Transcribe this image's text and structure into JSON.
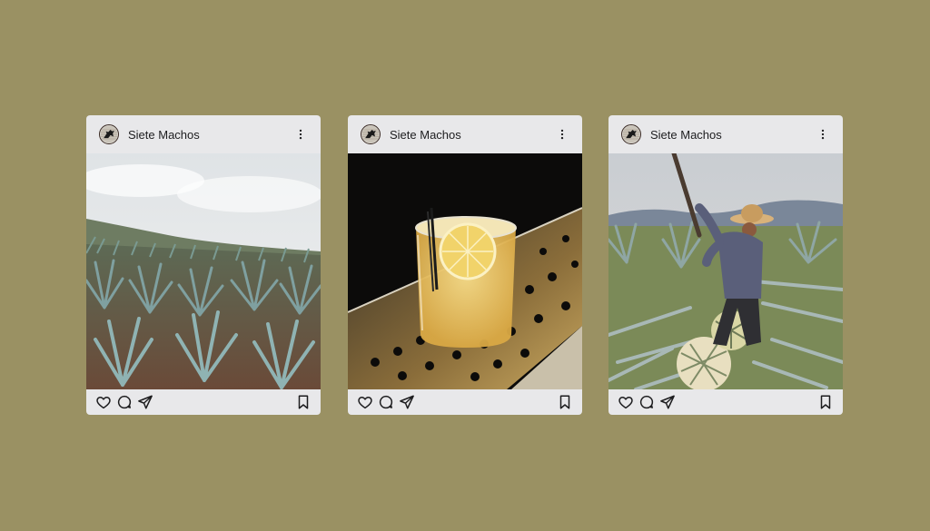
{
  "background_color": "#9a9163",
  "posts": [
    {
      "account_name": "Siete Machos",
      "photo_subject": "blue agave field under cloudy sky",
      "icons": [
        "heart-icon",
        "comment-icon",
        "share-icon",
        "bookmark-icon",
        "more-vertical-icon"
      ]
    },
    {
      "account_name": "Siete Machos",
      "photo_subject": "cocktail with lemon slice on bar mat",
      "icons": [
        "heart-icon",
        "comment-icon",
        "share-icon",
        "bookmark-icon",
        "more-vertical-icon"
      ]
    },
    {
      "account_name": "Siete Machos",
      "photo_subject": "jimador harvesting agave pinas",
      "icons": [
        "heart-icon",
        "comment-icon",
        "share-icon",
        "bookmark-icon",
        "more-vertical-icon"
      ]
    }
  ]
}
